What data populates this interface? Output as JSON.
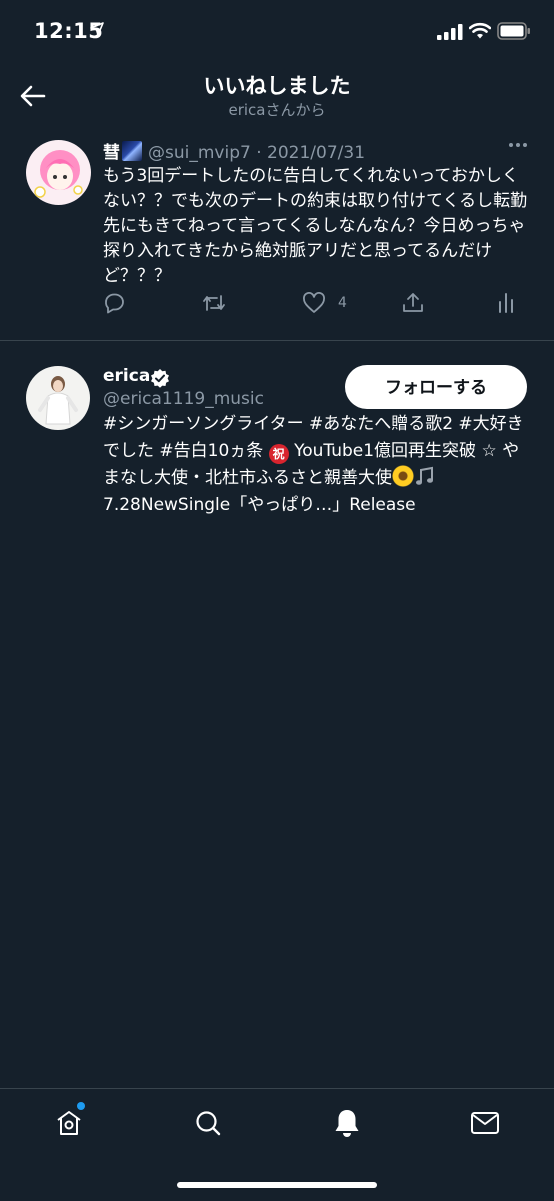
{
  "status_bar": {
    "time": "12:15"
  },
  "header": {
    "title": "いいねしました",
    "subtitle": "ericaさんから"
  },
  "tweet": {
    "author_name": "彗",
    "handle": "@sui_mvip7",
    "separator": " · ",
    "date": "2021/07/31",
    "text": "もう3回デートしたのに告白してくれないっておかしくない？？でも次のデートの約束は取り付けてくるし転勤先にもきてねって言ってくるしなんなん？今日めっちゃ探り入れてきたから絶対脈アリだと思ってるんだけど？？？",
    "like_count": "4"
  },
  "user": {
    "name": "erica",
    "handle": "@erica1119_music",
    "follow_label": "フォローする",
    "bio_part1": "#シンガーソングライター #あなたへ贈る歌2 #大好きでした #告白10ヵ条 ",
    "bio_iwai": "祝",
    "bio_part2": "YouTube1億回再生突破 ☆ やまなし大使・北杜市ふるさと親善大使",
    "bio_part3": "7.28NewSingle「やっぱり…」Release"
  },
  "colors": {
    "background": "#15202b",
    "accent": "#1d9bf0",
    "muted": "#8b98a5",
    "divider": "#38444d"
  },
  "icons": [
    "back-arrow-icon",
    "more-icon",
    "reply-icon",
    "retweet-icon",
    "like-icon",
    "share-icon",
    "analytics-icon",
    "verified-icon",
    "home-icon",
    "search-icon",
    "notifications-icon",
    "messages-icon"
  ]
}
